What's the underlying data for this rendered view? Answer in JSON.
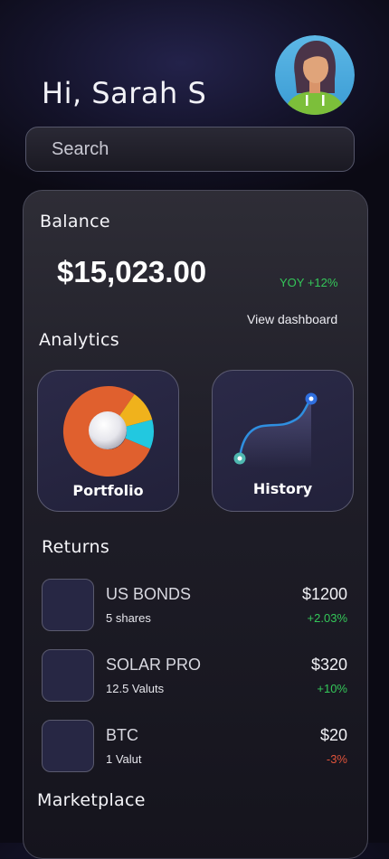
{
  "header": {
    "greeting": "Hi, Sarah S"
  },
  "search": {
    "placeholder": "Search",
    "value": ""
  },
  "balance": {
    "title": "Balance",
    "amount": "$15,023.00",
    "yoy": "YOY +12%",
    "view_dashboard": "View dashboard"
  },
  "analytics": {
    "title": "Analytics",
    "cards": [
      {
        "label": "Portfolio",
        "icon": "donut-chart-icon"
      },
      {
        "label": "History",
        "icon": "trend-line-icon"
      }
    ]
  },
  "returns": {
    "title": "Returns",
    "items": [
      {
        "name": "US BONDS",
        "sub": "5 shares",
        "price": "$1200",
        "change": "+2.03%"
      },
      {
        "name": "SOLAR PRO",
        "sub": "12.5 Valuts",
        "price": "$320",
        "change": "+10%"
      },
      {
        "name": "BTC",
        "sub": "1 Valut",
        "price": "$20",
        "change": "-3%"
      }
    ]
  },
  "marketplace": {
    "title": "Marketplace"
  },
  "colors": {
    "positive": "#34c759",
    "negative": "#e0533b",
    "donut_orange": "#e0602e",
    "donut_yellow": "#f0b21c",
    "donut_cyan": "#22c8e0",
    "accent_blue": "#2f7fe0"
  }
}
